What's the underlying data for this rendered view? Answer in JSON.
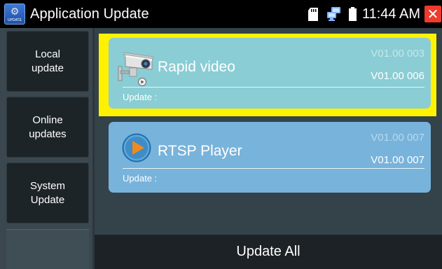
{
  "header": {
    "app_icon_caption": "UPDATE",
    "title": "Application Update",
    "time": "11:44 AM",
    "close_glyph": "✕",
    "icons": [
      "app-update-icon",
      "sd-card-icon",
      "network-icon",
      "battery-icon",
      "close-icon"
    ]
  },
  "sidebar": {
    "items": [
      {
        "label_line1": "Local",
        "label_line2": "update"
      },
      {
        "label_line1": "Online",
        "label_line2": "updates"
      },
      {
        "label_line1": "System",
        "label_line2": "Update"
      }
    ]
  },
  "apps": [
    {
      "name": "Rapid video",
      "version_current": "V01.00 003",
      "version_new": "V01.00 006",
      "update_label": "Update :",
      "icon": "camera-icon",
      "selected": true
    },
    {
      "name": "RTSP Player",
      "version_current": "V01.00 007",
      "version_new": "V01.00 007",
      "update_label": "Update :",
      "icon": "play-icon",
      "selected": false
    }
  ],
  "footer": {
    "update_all_label": "Update All"
  },
  "colors": {
    "highlight": "#fff200",
    "card_rapid_video": "#8acdd4",
    "card_rtsp_player": "#78b3db",
    "close_button": "#ef3a2e",
    "play_orange": "#f08a1c"
  }
}
